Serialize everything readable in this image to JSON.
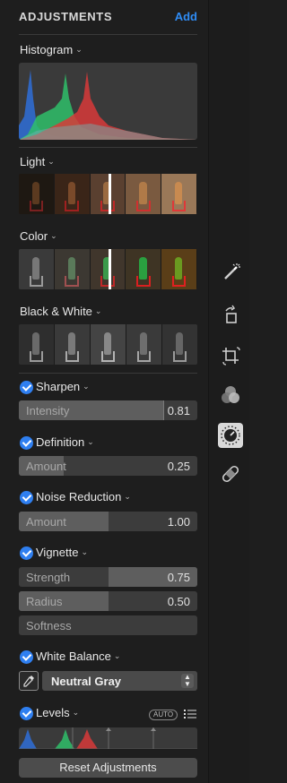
{
  "header": {
    "title": "ADJUSTMENTS",
    "add_label": "Add"
  },
  "histogram": {
    "title": "Histogram"
  },
  "light": {
    "title": "Light"
  },
  "color": {
    "title": "Color"
  },
  "black_white": {
    "title": "Black & White"
  },
  "sharpen": {
    "title": "Sharpen",
    "enabled": true,
    "sliders": [
      {
        "label": "Intensity",
        "value": "0.81",
        "fraction": 0.81
      }
    ]
  },
  "definition": {
    "title": "Definition",
    "enabled": true,
    "sliders": [
      {
        "label": "Amount",
        "value": "0.25",
        "fraction": 0.25
      }
    ]
  },
  "noise_reduction": {
    "title": "Noise Reduction",
    "enabled": true,
    "sliders": [
      {
        "label": "Amount",
        "value": "1.00",
        "fraction": 0.5
      }
    ]
  },
  "vignette": {
    "title": "Vignette",
    "enabled": true,
    "sliders": [
      {
        "label": "Strength",
        "value": "0.75",
        "fraction": 0.5
      },
      {
        "label": "Radius",
        "value": "0.50",
        "fraction": 0.5
      },
      {
        "label": "Softness",
        "value": "",
        "fraction": 0
      }
    ]
  },
  "white_balance": {
    "title": "White Balance",
    "enabled": true,
    "mode": "Neutral Gray"
  },
  "levels": {
    "title": "Levels",
    "enabled": true,
    "auto_label": "AUTO"
  },
  "reset_label": "Reset Adjustments",
  "toolbar": [
    "magic-wand-icon",
    "rotate-icon",
    "crop-icon",
    "filters-icon",
    "adjust-icon",
    "retouch-icon"
  ],
  "colors": {
    "accent": "#2f8cf5",
    "panel_bg": "#1e1e1e",
    "slider_track": "#3c3c3c",
    "slider_fill": "#5e5e5e"
  }
}
